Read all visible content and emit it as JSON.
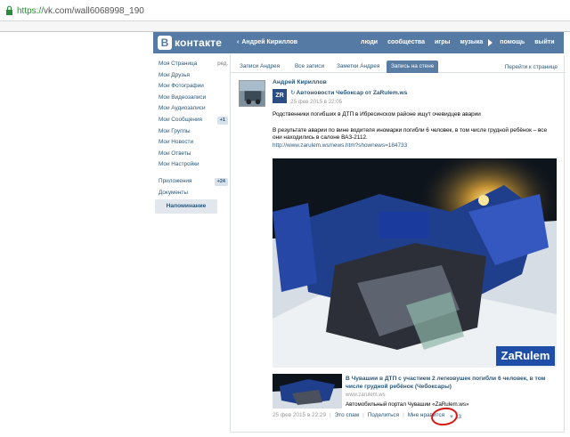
{
  "browser": {
    "url_scheme": "https://",
    "url_rest": "vk.com/wall6068998_190"
  },
  "header": {
    "logo_letter": "В",
    "logo_text": "контакте",
    "user_name": "Андрей Кириллов",
    "nav": [
      "люди",
      "сообщества",
      "игры",
      "музыка",
      "помощь",
      "выйти"
    ]
  },
  "leftmenu": {
    "items": [
      {
        "label": "Моя Страница",
        "extra": "ред."
      },
      {
        "label": "Мои Друзья"
      },
      {
        "label": "Мои Фотографии"
      },
      {
        "label": "Мои Видеозаписи"
      },
      {
        "label": "Мои Аудиозаписи"
      },
      {
        "label": "Мои Сообщения",
        "badge": "+1"
      },
      {
        "label": "Мои Группы"
      },
      {
        "label": "Мои Новости"
      },
      {
        "label": "Мои Ответы"
      },
      {
        "label": "Мои Настройки"
      }
    ],
    "items2": [
      {
        "label": "Приложения",
        "badge": "+24"
      },
      {
        "label": "Документы"
      }
    ],
    "reminder": "Напоминание"
  },
  "tabs": {
    "items": [
      "Записи Андрея",
      "Все записи",
      "Заметки Андрея",
      "Запись на стене"
    ],
    "active": 3,
    "goto": "Перейти к странице"
  },
  "post": {
    "author": "Андрей Кириллов",
    "repost_icon": "ZR",
    "source": "Автоновости Чебоксар от ZaRulem.ws",
    "source_date": "25 фев 2015 в 22:05",
    "p1": "Родственники погибших в ДТП в Ибресинском районе ищут очевидцев аварии",
    "p2": "В результате аварии по вине водителя иномарки погибли 6 человек, в том числе грудной ребёнок – все они находились в салоне ВАЗ-2112.",
    "link": "http://www.zarulem.ws/news.htm?shownews=184733",
    "watermark": "ZaRulem",
    "card": {
      "title": "В Чувашии в ДТП с участием 2 легковушек погибли 6 человек, в том числе грудной ребёнок (Чебоксары)",
      "domain": "www.zarulem.ws",
      "desc": "Автомобильный портал Чувашии «ZaRulem.ws»"
    },
    "footer": {
      "date": "25 фев 2015 в 22:29",
      "spam": "Это спам",
      "share": "Поделиться",
      "like": "Мне нравится",
      "likes_count": "13"
    }
  },
  "colors": {
    "header": "#557ba5",
    "link": "#2b587a",
    "annotation": "#d61818"
  }
}
